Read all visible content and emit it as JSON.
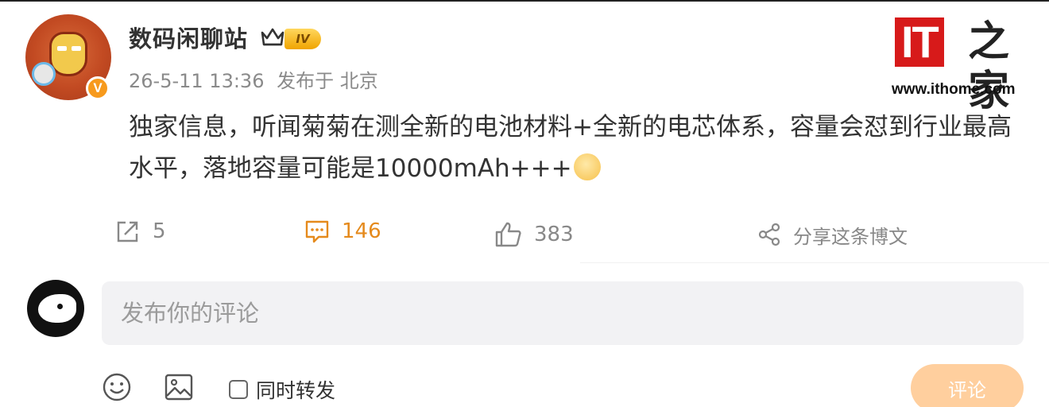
{
  "post": {
    "author": "数码闲聊站",
    "level": "IV",
    "verified_badge": "V",
    "time": "26-5-11 13:36",
    "location": "发布于 北京",
    "text": "独家信息，听闻菊菊在测全新的电池材料+全新的电芯体系，容量会怼到行业最高水平，落地容量可能是10000mAh+++"
  },
  "watermark": {
    "brand": "IT",
    "brand_cn": "之家",
    "url": "www.ithome.com"
  },
  "actions": {
    "repost_count": "5",
    "comment_count": "146",
    "like_count": "383",
    "share_label": "分享这条博文"
  },
  "composer": {
    "placeholder": "发布你的评论",
    "forward_label": "同时转发",
    "send_label": "评论"
  },
  "icons": {
    "repost": "repost-icon",
    "comment": "comment-icon",
    "like": "thumbs-up-icon",
    "share": "share-icon",
    "emoji": "emoji-icon",
    "image": "image-icon",
    "crown": "crown-icon"
  },
  "colors": {
    "accent": "#e58a1c",
    "verified": "#f79a1d",
    "level": "#f0a400",
    "brand_red": "#d71a1a",
    "send_button": "#ffcf9e"
  }
}
